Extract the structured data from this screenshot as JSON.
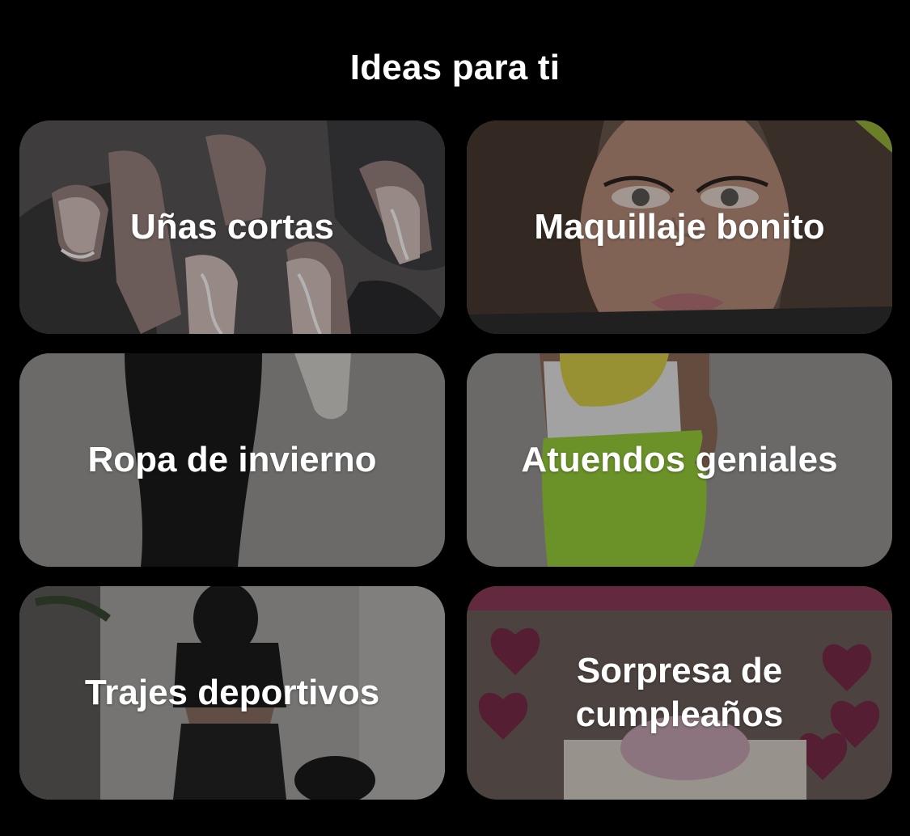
{
  "header": {
    "title": "Ideas para ti"
  },
  "ideas": [
    {
      "label_lines": [
        "Uñas cortas"
      ]
    },
    {
      "label_lines": [
        "Maquillaje bonito"
      ]
    },
    {
      "label_lines": [
        "Ropa de invierno"
      ]
    },
    {
      "label_lines": [
        "Atuendos geniales"
      ]
    },
    {
      "label_lines": [
        "Trajes deportivos"
      ]
    },
    {
      "label_lines": [
        "Sorpresa de",
        "cumpleaños"
      ]
    }
  ],
  "colors": {
    "background": "#000000",
    "text": "#ffffff"
  }
}
